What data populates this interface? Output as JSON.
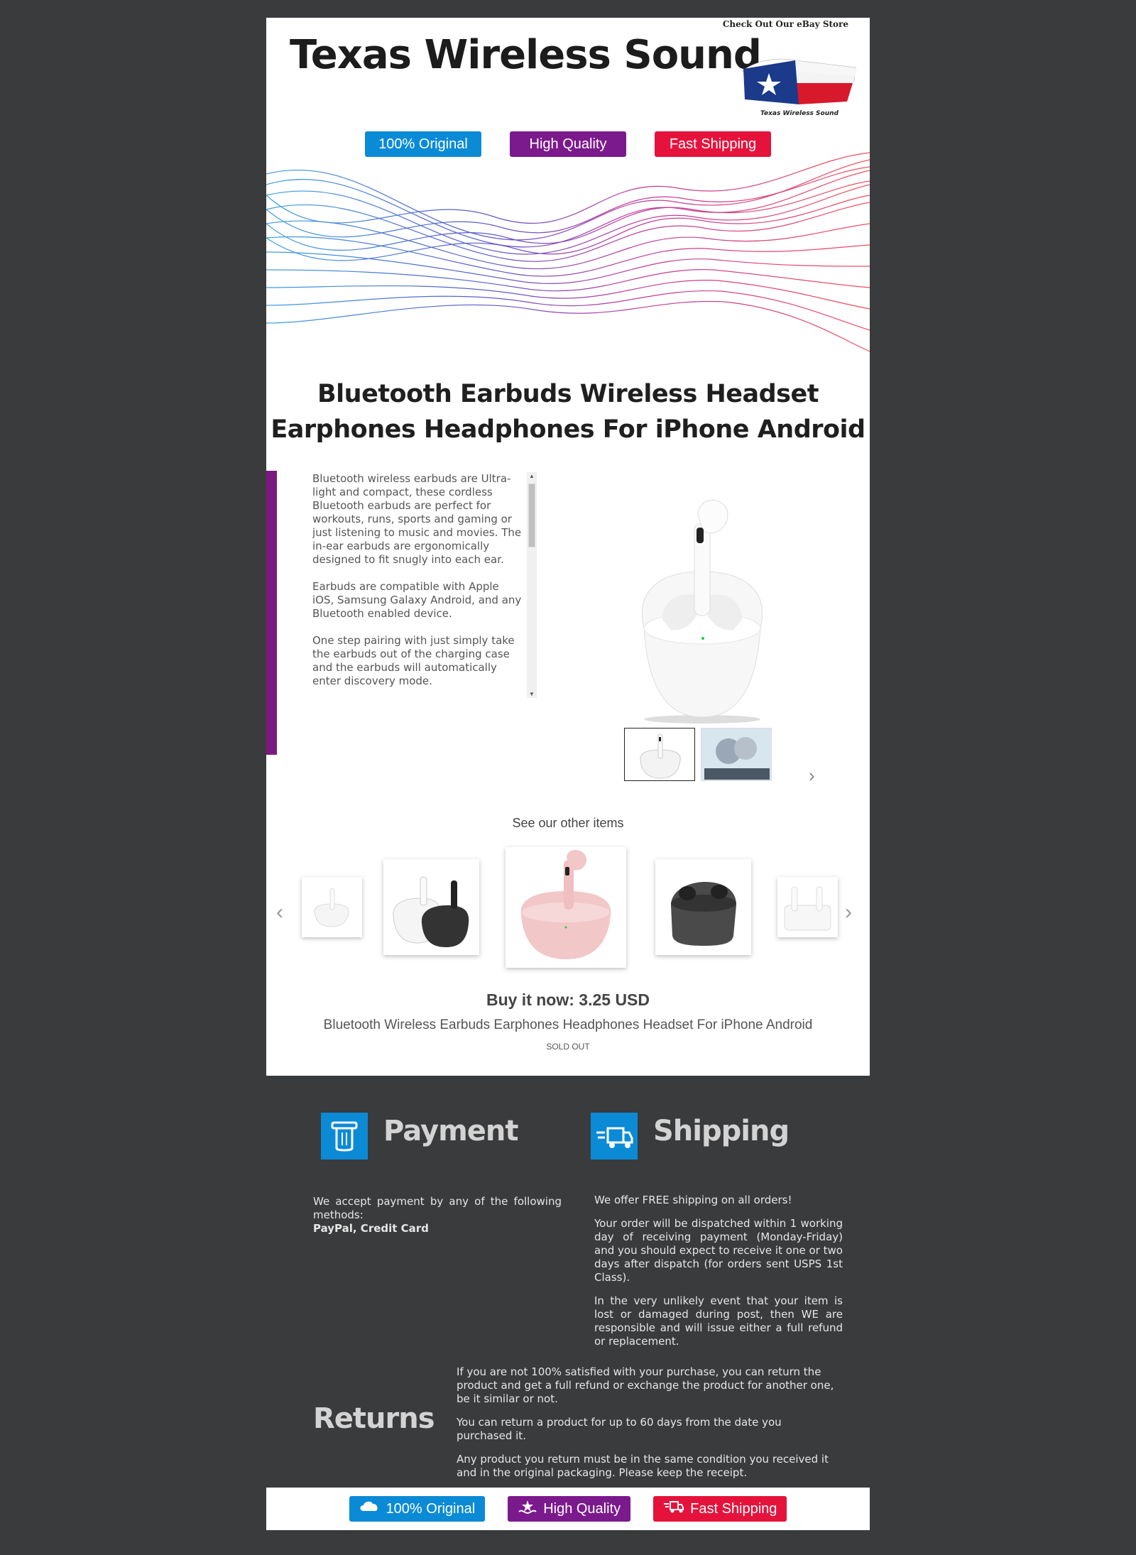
{
  "header": {
    "store_title": "Texas Wireless Sound",
    "ebay_link": "Check Out Our eBay Store",
    "logo_caption": "Texas Wireless Sound"
  },
  "badges": [
    "100% Original",
    "High Quality",
    "Fast Shipping"
  ],
  "colors": {
    "blue": "#0b8ad6",
    "purple": "#7b1a8c",
    "red": "#e5133c",
    "dark": "#3a3b3d"
  },
  "product": {
    "title_line1": "Bluetooth Earbuds Wireless Headset",
    "title_line2": "Earphones Headphones For iPhone Android",
    "description": [
      "Bluetooth wireless earbuds are Ultra-light and compact, these cordless Bluetooth earbuds are perfect for workouts, runs, sports and gaming or just listening to music and movies. The in-ear earbuds are ergonomically designed to fit snugly into each ear.",
      "Earbuds are compatible with Apple iOS, Samsung Galaxy Android, and any Bluetooth enabled device.",
      "One step pairing with just simply take the earbuds out of the charging case and the earbuds will automatically enter discovery mode."
    ]
  },
  "other_items": {
    "heading": "See our other items",
    "buy_now": "Buy it now: 3.25 USD",
    "item_title": "Bluetooth Wireless Earbuds Earphones Headphones Headset For iPhone Android",
    "status": "SOLD OUT"
  },
  "payment": {
    "heading": "Payment",
    "text": "We accept payment by any of the following methods:",
    "methods": "PayPal, Credit Card"
  },
  "shipping": {
    "heading": "Shipping",
    "p1": "We offer FREE shipping on all orders!",
    "p2": "Your order will be dispatched within 1 working day of receiving payment (Monday-Friday) and you should expect to receive it one or two days after dispatch (for orders sent USPS 1st Class).",
    "p3": "In the very unlikely event that your item is lost or damaged during post, then WE are responsible and will issue either a full refund or replacement."
  },
  "returns": {
    "heading": "Returns",
    "p1": "If you are not 100% satisfied with your purchase, you can return the product and get a full refund or exchange the product for another one, be it similar or not.",
    "p2": "You can return a product for up to 60 days from the date you purchased it.",
    "p3": "Any product you return must be in the same condition you received it and in the original packaging. Please keep the receipt."
  },
  "icons": [
    "payment-icon",
    "shipping-truck-icon",
    "cloud-icon",
    "star-hand-icon",
    "truck-icon",
    "chevron-left-icon",
    "chevron-right-icon"
  ]
}
